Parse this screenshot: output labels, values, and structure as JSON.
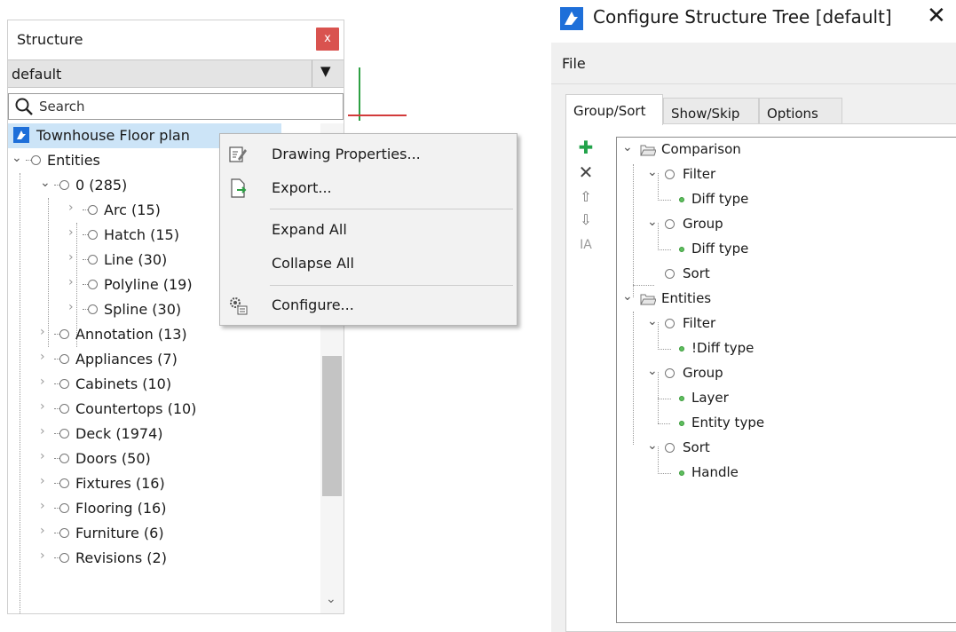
{
  "structure_panel": {
    "title": "Structure",
    "close_label": "x",
    "profile": "default",
    "search_placeholder": "Search",
    "root_label": "Townhouse Floor plan",
    "entities_label": "Entities",
    "layer0_label": "0 (285)",
    "layer0_children": [
      "Arc (15)",
      "Hatch (15)",
      "Line (30)",
      "Polyline (19)",
      "Spline (30)"
    ],
    "layers": [
      "Annotation (13)",
      "Appliances (7)",
      "Cabinets (10)",
      "Countertops (10)",
      "Deck (1974)",
      "Doors (50)",
      "Fixtures (16)",
      "Flooring (16)",
      "Furniture (6)",
      "Revisions (2)"
    ]
  },
  "context_menu": {
    "items": [
      "Drawing Properties...",
      "Export...",
      "Expand All",
      "Collapse All",
      "Configure..."
    ]
  },
  "dialog": {
    "title": "Configure Structure Tree [default]",
    "close_symbol": "✕",
    "menu_file": "File",
    "tabs": [
      "Group/Sort",
      "Show/Skip",
      "Options"
    ],
    "toolbar": [
      "add-icon",
      "delete-icon",
      "move-up-icon",
      "move-down-icon",
      "rename-icon"
    ],
    "toolbar_glyphs": {
      "add": "✚",
      "delete": "✕",
      "up": "⇧",
      "down": "⇩",
      "rename": "IA"
    },
    "tree": {
      "comparison": "Comparison",
      "comparison_filter": "Filter",
      "comparison_filter_item": "Diff type",
      "comparison_group": "Group",
      "comparison_group_item": "Diff type",
      "comparison_sort": "Sort",
      "entities": "Entities",
      "entities_filter": "Filter",
      "entities_filter_item": "!Diff type",
      "entities_group": "Group",
      "entities_group_items": [
        "Layer",
        "Entity type"
      ],
      "entities_sort": "Sort",
      "entities_sort_item": "Handle"
    }
  },
  "colors": {
    "selection": "#cce4f7",
    "close_button": "#d9534f",
    "add_green": "#22a34a",
    "brand_blue": "#1e6fd9"
  }
}
